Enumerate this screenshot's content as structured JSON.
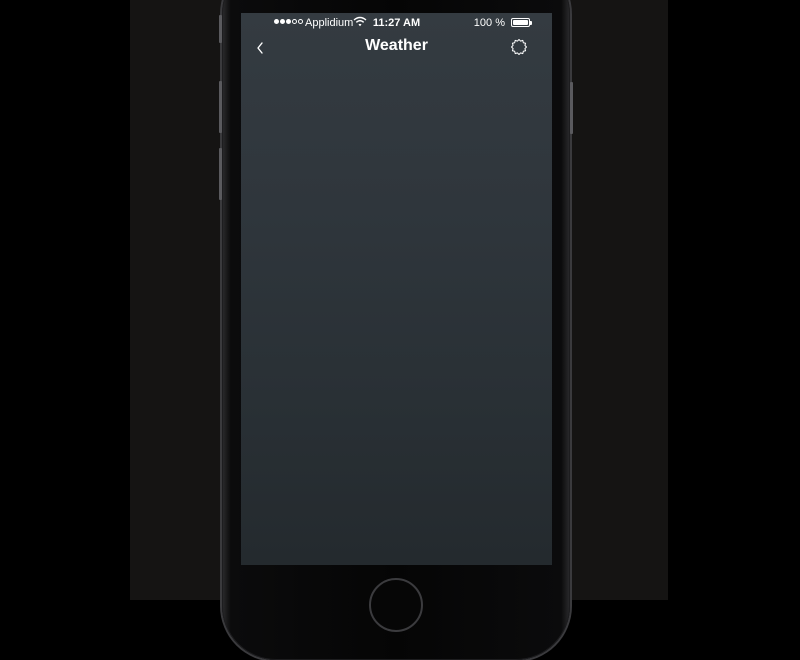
{
  "status_bar": {
    "carrier": "Applidium",
    "time": "11:27 AM",
    "battery_text": "100 %",
    "signal_strength": {
      "filled": 3,
      "total": 5
    },
    "battery_level": 1.0
  },
  "nav_bar": {
    "title": "Weather",
    "back_icon": "chevron-left-icon",
    "settings_icon": "gear-icon"
  },
  "colors": {
    "screen_top": "#343b41",
    "screen_bottom": "#242a2e",
    "text": "#ffffff",
    "backdrop": "#151413"
  }
}
